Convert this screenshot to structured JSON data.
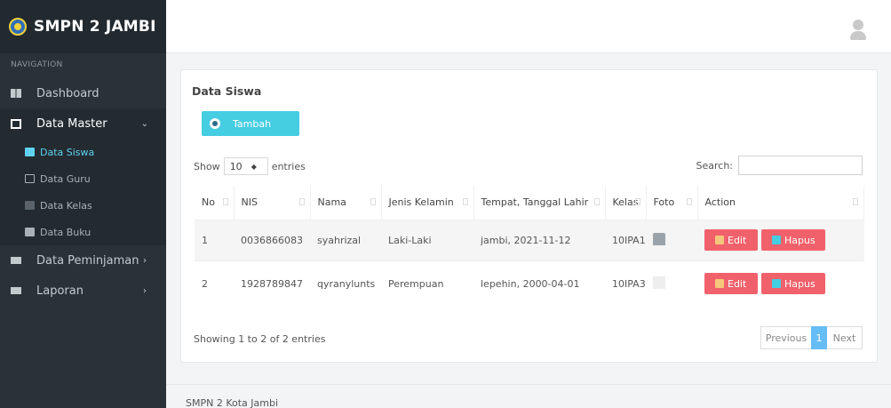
{
  "brand": {
    "name": "SMPN 2 JAMBI"
  },
  "nav": {
    "header": "NAVIGATION",
    "dashboard": "Dashboard",
    "data_master": "Data Master",
    "sub_items": [
      "Data Siswa",
      "Data Guru",
      "Data Kelas",
      "Data Buku"
    ],
    "data_peminjaman": "Data Peminjaman",
    "laporan": "Laporan"
  },
  "panel": {
    "title": "Data Siswa",
    "add_button": "Tambah",
    "show_label": "Show",
    "entries_value": "10",
    "entries_label": "entries",
    "search_label": "Search:",
    "search_value": ""
  },
  "table": {
    "headers": [
      "No",
      "NIS",
      "Nama",
      "Jenis Kelamin",
      "Tempat, Tanggal Lahir",
      "Kelas",
      "Foto",
      "Action"
    ],
    "rows": [
      {
        "no": "1",
        "nis": "0036866083",
        "nama": "syahrizal",
        "jk": "Laki-Laki",
        "ttl": "jambi, 2021-11-12",
        "kelas": "10IPA1"
      },
      {
        "no": "2",
        "nis": "1928789847",
        "nama": "qyranylunts",
        "jk": "Perempuan",
        "ttl": "lepehin, 2000-04-01",
        "kelas": "10IPA3"
      }
    ],
    "edit_label": "Edit",
    "delete_label": "Hapus"
  },
  "footer_table": {
    "info": "Showing 1 to 2 of 2 entries",
    "previous": "Previous",
    "current_page": "1",
    "next": "Next"
  },
  "footer": {
    "text": "SMPN 2 Kota Jambi"
  },
  "colors": {
    "sidebar": "#2a3238",
    "accent": "#45cde2",
    "danger": "#f0616b",
    "page_active": "#66bcf5"
  }
}
